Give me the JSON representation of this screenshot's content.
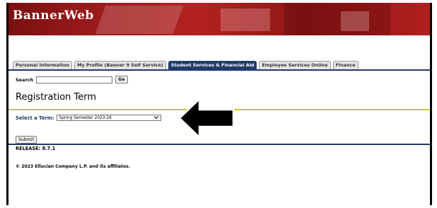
{
  "app": {
    "logo_text": "BannerWeb"
  },
  "tabs": [
    {
      "label": "Personal Information"
    },
    {
      "label": "My Profile (Banner 9 Self Service)"
    },
    {
      "label": "Student Services & Financial Aid",
      "active": true
    },
    {
      "label": "Employee Services Online"
    },
    {
      "label": "Finance"
    }
  ],
  "search": {
    "label": "Search",
    "value": "",
    "go_label": "Go"
  },
  "page": {
    "title": "Registration Term"
  },
  "term_select": {
    "label": "Select a Term:",
    "selected": "Spring Semester 2023-24"
  },
  "submit_label": "Submit",
  "footer": {
    "release": "RELEASE: 8.7.1",
    "copyright": "© 2023 Ellucian Company L.P. and its affiliates."
  },
  "colors": {
    "banner_red": "#9a1b1b",
    "tab_active": "#1f3d6b",
    "divider_yellow": "#c9cc1f",
    "arrow": "#000000"
  },
  "icons": {
    "arrow": "left-arrow-icon",
    "dropdown": "chevron-down-icon"
  }
}
